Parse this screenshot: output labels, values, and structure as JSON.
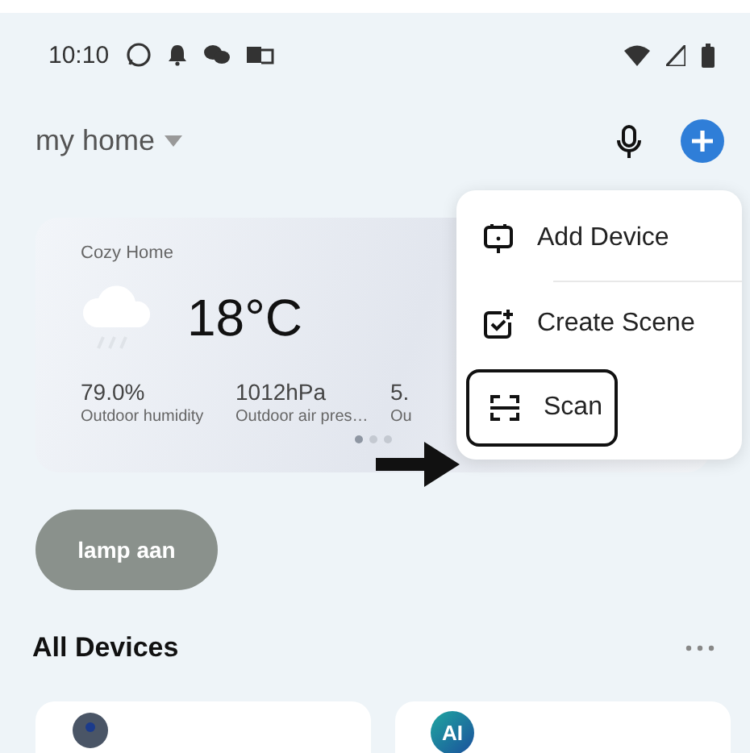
{
  "status_bar": {
    "time": "10:10"
  },
  "header": {
    "home_name": "my home"
  },
  "weather": {
    "home_label": "Cozy Home",
    "temperature": "18°C",
    "stats": [
      {
        "value": "79.0%",
        "label": "Outdoor humidity"
      },
      {
        "value": "1012hPa",
        "label": "Outdoor air pres…"
      },
      {
        "value": "5.",
        "label": "Ou"
      }
    ],
    "pages": [
      {
        "selected": true
      },
      {
        "selected": false
      },
      {
        "selected": false
      }
    ]
  },
  "menu": {
    "items": [
      {
        "kind": "add-device",
        "label": "Add Device",
        "highlighted": false
      },
      {
        "kind": "create-scene",
        "label": "Create Scene",
        "highlighted": false
      },
      {
        "kind": "scan",
        "label": "Scan",
        "highlighted": true
      }
    ]
  },
  "scenes": [
    {
      "label": "lamp aan"
    }
  ],
  "devices_section": {
    "title": "All Devices"
  },
  "devices": [
    {
      "kind": "camera"
    },
    {
      "kind": "ai",
      "badge": "AI"
    }
  ]
}
